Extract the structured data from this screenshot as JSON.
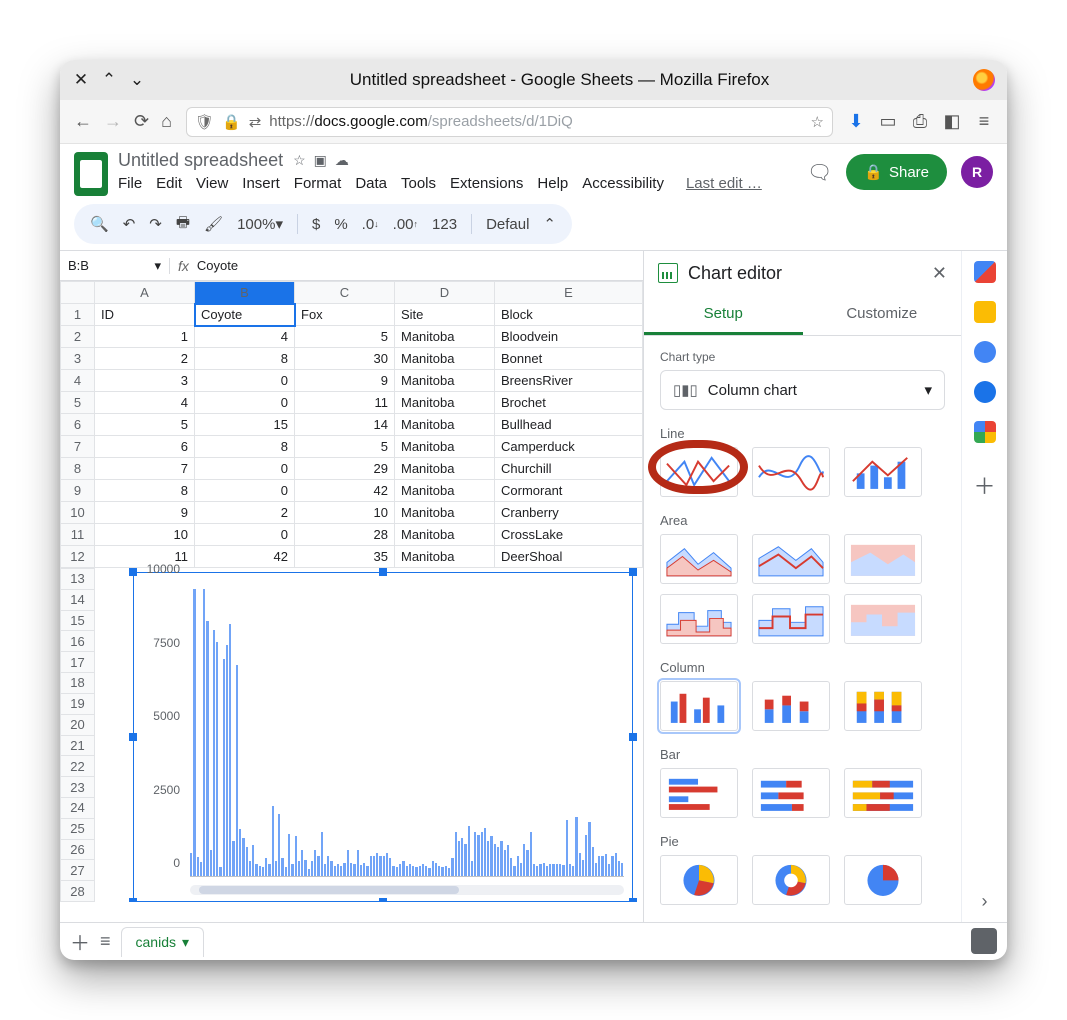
{
  "browser": {
    "title": "Untitled spreadsheet - Google Sheets — Mozilla Firefox",
    "url_proto": "https://",
    "url_host": "docs.google.com",
    "url_path": "/spreadsheets/d/1DiQ"
  },
  "doc": {
    "title": "Untitled spreadsheet",
    "menus": [
      "File",
      "Edit",
      "View",
      "Insert",
      "Format",
      "Data",
      "Tools",
      "Extensions",
      "Help",
      "Accessibility"
    ],
    "last_edit": "Last edit …",
    "share": "Share",
    "avatar": "R"
  },
  "toolbar": {
    "zoom": "100%",
    "currency": "$",
    "percent": "%",
    "dec_dec": ".0",
    "dec_inc": ".00",
    "num123": "123",
    "font": "Defaul"
  },
  "fx": {
    "ref": "B:B",
    "label": "fx",
    "val": "Coyote"
  },
  "sheet": {
    "columns": [
      "A",
      "B",
      "C",
      "D",
      "E"
    ],
    "header_row": [
      "ID",
      "Coyote",
      "Fox",
      "Site",
      "Block"
    ],
    "rows": [
      {
        "n": 1,
        "id": 1,
        "coy": 4,
        "fox": 5,
        "site": "Manitoba",
        "block": "Bloodvein"
      },
      {
        "n": 2,
        "id": 2,
        "coy": 8,
        "fox": 30,
        "site": "Manitoba",
        "block": "Bonnet"
      },
      {
        "n": 3,
        "id": 3,
        "coy": 0,
        "fox": 9,
        "site": "Manitoba",
        "block": "BreensRiver"
      },
      {
        "n": 4,
        "id": 4,
        "coy": 0,
        "fox": 11,
        "site": "Manitoba",
        "block": "Brochet"
      },
      {
        "n": 5,
        "id": 5,
        "coy": 15,
        "fox": 14,
        "site": "Manitoba",
        "block": "Bullhead"
      },
      {
        "n": 6,
        "id": 6,
        "coy": 8,
        "fox": 5,
        "site": "Manitoba",
        "block": "Camperduck"
      },
      {
        "n": 7,
        "id": 7,
        "coy": 0,
        "fox": 29,
        "site": "Manitoba",
        "block": "Churchill"
      },
      {
        "n": 8,
        "id": 8,
        "coy": 0,
        "fox": 42,
        "site": "Manitoba",
        "block": "Cormorant"
      },
      {
        "n": 9,
        "id": 9,
        "coy": 2,
        "fox": 10,
        "site": "Manitoba",
        "block": "Cranberry"
      },
      {
        "n": 10,
        "id": 10,
        "coy": 0,
        "fox": 28,
        "site": "Manitoba",
        "block": "CrossLake"
      },
      {
        "n": 11,
        "id": 11,
        "coy": 42,
        "fox": 35,
        "site": "Manitoba",
        "block": "DeerShoal"
      }
    ],
    "extra_rows": [
      13,
      14,
      15,
      16,
      17,
      18,
      19,
      20,
      21,
      22,
      23,
      24,
      25,
      26,
      27,
      28
    ],
    "tab_name": "canids"
  },
  "chart_data": {
    "type": "bar",
    "title": "",
    "ylabel": "",
    "ylim": [
      0,
      10000
    ],
    "yticks": [
      0,
      2500,
      5000,
      7500,
      10000
    ],
    "note": "values approximate, read from embedded column chart (~130 categories)",
    "values": [
      780,
      9800,
      650,
      470,
      9800,
      8700,
      900,
      8400,
      8000,
      300,
      7400,
      7900,
      8600,
      1200,
      7200,
      1600,
      1300,
      1000,
      500,
      1050,
      400,
      350,
      300,
      600,
      400,
      2400,
      500,
      2100,
      600,
      300,
      1450,
      400,
      1350,
      500,
      900,
      550,
      250,
      500,
      900,
      700,
      1500,
      400,
      700,
      500,
      330,
      400,
      330,
      450,
      900,
      450,
      400,
      900,
      380,
      430,
      330,
      700,
      700,
      800,
      700,
      700,
      800,
      600,
      350,
      300,
      400,
      500,
      330,
      400,
      350,
      300,
      350,
      400,
      330,
      280,
      500,
      450,
      350,
      300,
      330,
      280,
      600,
      1500,
      1200,
      1300,
      1100,
      1700,
      500,
      1500,
      1400,
      1500,
      1650,
      1200,
      1350,
      1100,
      1000,
      1200,
      900,
      1050,
      600,
      350,
      700,
      450,
      1100,
      900,
      1500,
      400,
      350,
      400,
      450,
      350,
      400,
      400,
      400,
      400,
      380,
      1900,
      400,
      350,
      2000,
      800,
      550,
      1400,
      1850,
      1000,
      450,
      700,
      700,
      750,
      400,
      700,
      800,
      500,
      450
    ]
  },
  "chart_editor": {
    "title": "Chart editor",
    "tabs": {
      "setup": "Setup",
      "custom": "Customize"
    },
    "chart_type_label": "Chart type",
    "chart_type_value": "Column chart",
    "sections": {
      "line": "Line",
      "area": "Area",
      "column": "Column",
      "bar": "Bar",
      "pie": "Pie"
    }
  }
}
